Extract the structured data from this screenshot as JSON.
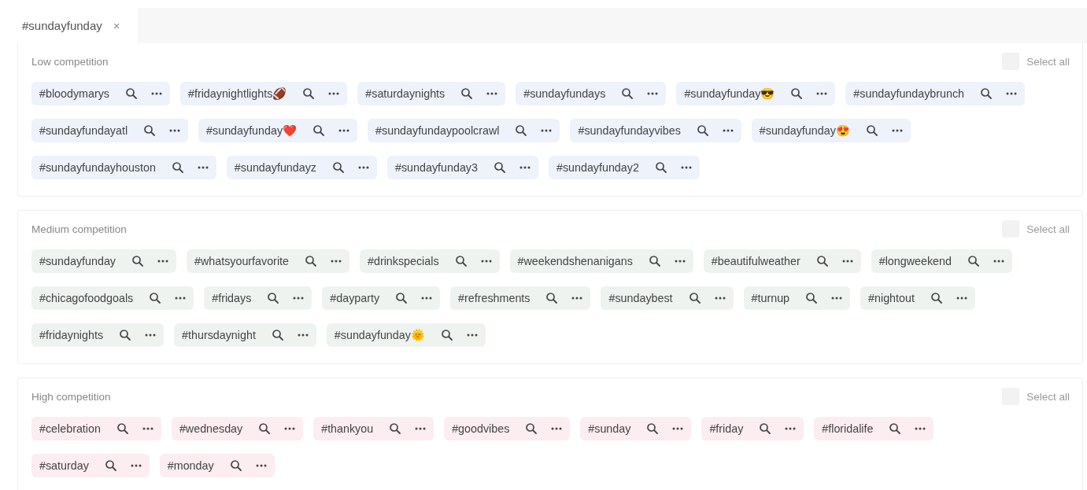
{
  "tab": {
    "label": "#sundayfunday",
    "close": "×",
    "selected": true
  },
  "sections": [
    {
      "kind": "low",
      "title": "Low competition",
      "select_all": {
        "label": "Select all",
        "checked": false
      },
      "tags": [
        "#bloodymarys",
        "#fridaynightlights🏈",
        "#saturdaynights",
        "#sundayfundays",
        "#sundayfunday😎",
        "#sundayfundaybrunch",
        "#sundayfundayatl",
        "#sundayfunday❤️",
        "#sundayfundaypoolcrawl",
        "#sundayfundayvibes",
        "#sundayfunday😍",
        "#sundayfundayhouston",
        "#sundayfundayz",
        "#sundayfunday3",
        "#sundayfunday2"
      ]
    },
    {
      "kind": "medium",
      "title": "Medium competition",
      "select_all": {
        "label": "Select all",
        "checked": false
      },
      "tags": [
        "#sundayfunday",
        "#whatsyourfavorite",
        "#drinkspecials",
        "#weekendshenanigans",
        "#beautifulweather",
        "#longweekend",
        "#chicagofoodgoals",
        "#fridays",
        "#dayparty",
        "#refreshments",
        "#sundaybest",
        "#turnup",
        "#nightout",
        "#fridaynights",
        "#thursdaynight",
        "#sundayfunday🌞"
      ]
    },
    {
      "kind": "high",
      "title": "High competition",
      "select_all": {
        "label": "Select all",
        "checked": false
      },
      "tags": [
        "#celebration",
        "#wednesday",
        "#thankyou",
        "#goodvibes",
        "#sunday",
        "#friday",
        "#floridalife",
        "#saturday",
        "#monday"
      ]
    }
  ]
}
